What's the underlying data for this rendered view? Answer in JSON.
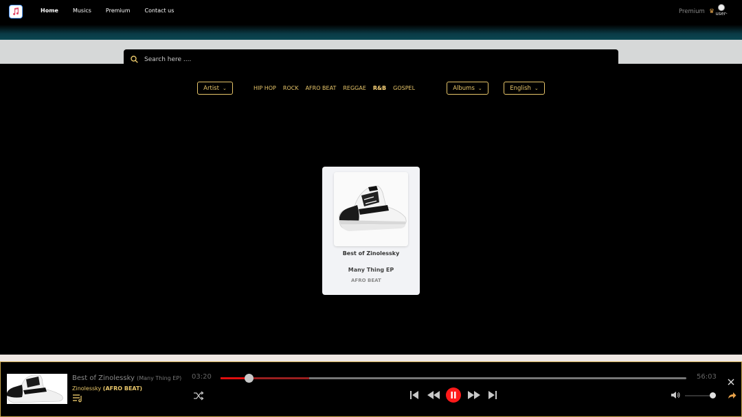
{
  "nav": {
    "items": [
      {
        "label": "Home",
        "active": true
      },
      {
        "label": "Musics",
        "active": false
      },
      {
        "label": "Premium",
        "active": false
      },
      {
        "label": "Contact us",
        "active": false
      }
    ],
    "premium_label": "Premium",
    "user_label": "user-"
  },
  "search": {
    "placeholder": "Search here ...."
  },
  "filters": {
    "artist_label": "Artist",
    "genres": [
      "HIP HOP",
      "ROCK",
      "AFRO BEAT",
      "REGGAE",
      "R&B",
      "GOSPEL"
    ],
    "active_genre": "R&B",
    "albums_label": "Albums",
    "language_label": "English"
  },
  "card": {
    "title": "Best of Zinolessky",
    "album": "Many Thing EP",
    "genre": "AFRO BEAT"
  },
  "player": {
    "title": "Best of Zinolessky",
    "album": "(Many Thing EP)",
    "artist": "Zinolessky",
    "genre": "(AFRO BEAT)",
    "current_time": "03:20",
    "total_time": "56:03",
    "progress_fraction": 0.06,
    "buffer_fraction": 0.19,
    "volume_fraction": 0.9
  },
  "colors": {
    "accent_gold": "#e8c66a",
    "play_red": "#ff1a1a",
    "progress_red": "#e10e0e"
  }
}
